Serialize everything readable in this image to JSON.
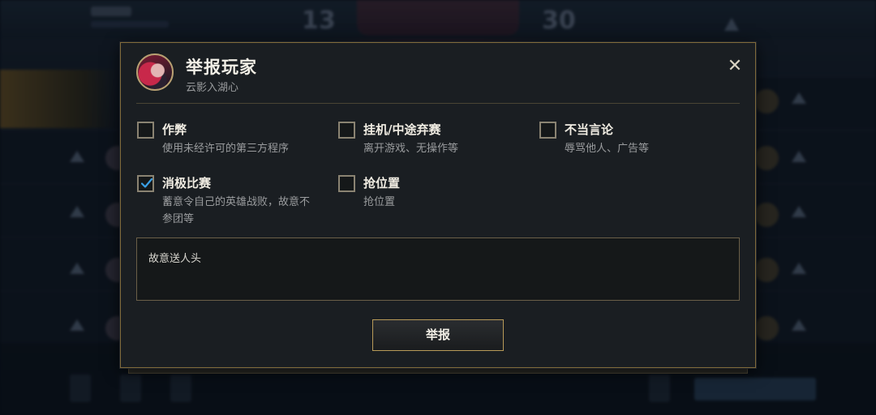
{
  "dialog": {
    "title": "举报玩家",
    "player_name": "云影入湖心",
    "close_symbol": "✕"
  },
  "options": [
    {
      "label": "作弊",
      "description": "使用未经许可的第三方程序",
      "checked": false
    },
    {
      "label": "挂机/中途弃赛",
      "description": "离开游戏、无操作等",
      "checked": false
    },
    {
      "label": "不当言论",
      "description": "辱骂他人、广告等",
      "checked": false
    },
    {
      "label": "消极比赛",
      "description": "蓄意令自己的英雄战败，故意不参团等",
      "checked": true
    },
    {
      "label": "抢位置",
      "description": "抢位置",
      "checked": false
    }
  ],
  "comment": {
    "value": "故意送人头"
  },
  "submit_label": "举报",
  "background": {
    "score_left": "13",
    "score_right": "30"
  },
  "colors": {
    "accent_gold": "#b89a58",
    "check_blue": "#3aa0e6",
    "panel": "#1a1e22"
  }
}
